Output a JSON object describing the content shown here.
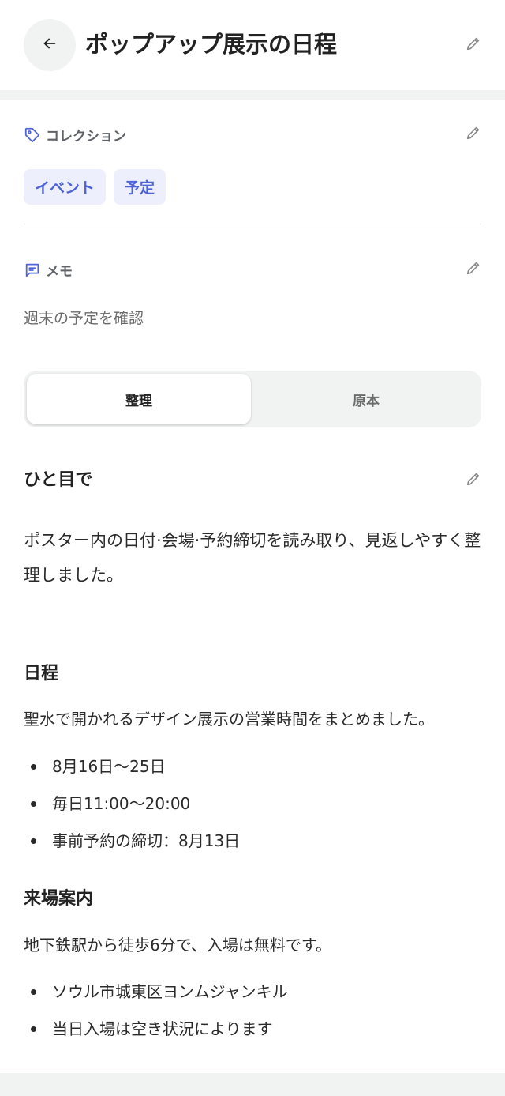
{
  "header": {
    "title": "ポップアップ展示の日程",
    "back_icon": "arrow-left-icon",
    "edit_icon": "pencil-icon"
  },
  "collection": {
    "label": "コレクション",
    "icon": "tag-icon",
    "tags": [
      "イベント",
      "予定"
    ]
  },
  "memo": {
    "label": "メモ",
    "icon": "message-icon",
    "text": "週末の予定を確認"
  },
  "view_toggle": {
    "options": [
      "整理",
      "原本"
    ],
    "selected": "整理"
  },
  "summary": {
    "heading": "ひと目で",
    "body": "ポスター内の日付·会場·予約締切を読み取り、見返しやすく整理しました。"
  },
  "schedule": {
    "heading": "日程",
    "description": "聖水で開かれるデザイン展示の営業時間をまとめました。",
    "items": [
      "8月16日～25日",
      "毎日11:00～20:00",
      "事前予約の締切：8月13日"
    ]
  },
  "visit": {
    "heading": "来場案内",
    "description": "地下鉄駅から徒歩6分で、入場は無料です。",
    "items": [
      "ソウル市城東区ヨンムジャンキル",
      "当日入場は空き状況によります"
    ]
  },
  "colors": {
    "accent": "#4f63d8",
    "chip_bg": "#edf0fc",
    "band": "#f1f2f2",
    "text_muted": "#6b6b6b"
  }
}
